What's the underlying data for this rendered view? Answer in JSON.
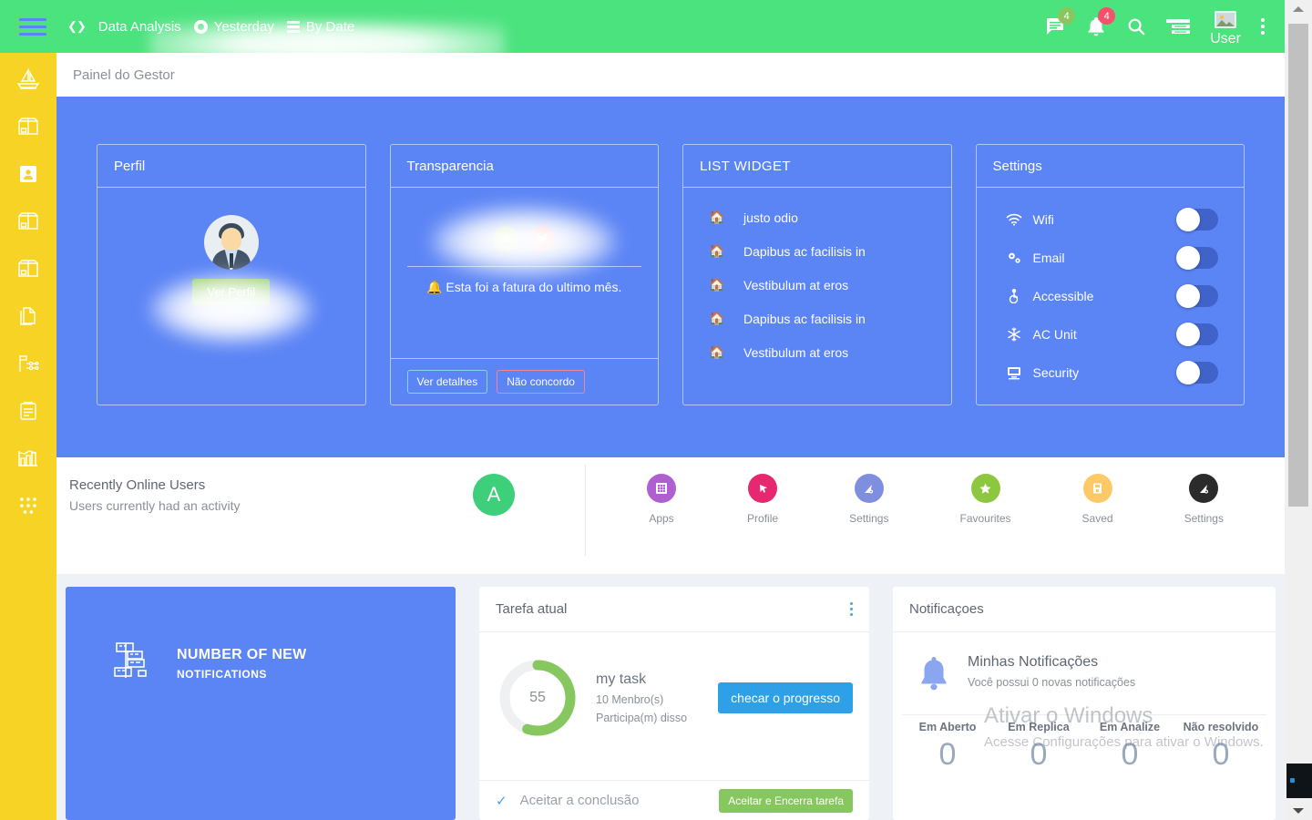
{
  "topbar": {
    "code_icon": "code-icon",
    "items": [
      {
        "label": "Data Analysis",
        "icon": "none"
      },
      {
        "label": "Yesterday",
        "icon": "clock-icon"
      },
      {
        "label": "By Date",
        "icon": "bars-icon"
      }
    ],
    "messages_badge": "4",
    "notifications_badge": "4",
    "user_label": "User",
    "colors": {
      "bar": "#4ae37e",
      "badge_green": "#87c75f",
      "badge_red": "#f4516c"
    }
  },
  "sidebar": {
    "items": [
      {
        "icon": "sailboat-icon"
      },
      {
        "icon": "box-icon"
      },
      {
        "icon": "contact-card-icon"
      },
      {
        "icon": "box-icon"
      },
      {
        "icon": "box-icon"
      },
      {
        "icon": "documents-icon"
      },
      {
        "icon": "flowchart-icon"
      },
      {
        "icon": "clipboard-icon"
      },
      {
        "icon": "bar-chart-icon"
      },
      {
        "icon": "grid-dots-icon"
      }
    ],
    "color": "#f7d325"
  },
  "breadcrumb": {
    "title": "Painel do Gestor"
  },
  "panel": {
    "color": "#5b84f5",
    "profile_card": {
      "title": "Perfil",
      "avatar": "user-avatar",
      "name_redacted": "",
      "email_redacted": "",
      "button": "Ver Perfil"
    },
    "transparencia_card": {
      "title": "Transparencia",
      "amount_redacted": "",
      "up_icon": "double-chevron-up-icon",
      "down_icon": "double-chevron-down-icon",
      "note": "Esta foi a fatura do ultimo mês.",
      "note_icon": "bell-icon",
      "btn_details": "Ver detalhes",
      "btn_disagree": "Não concordo"
    },
    "list_widget": {
      "title": "LIST WIDGET",
      "items": [
        {
          "icon": "home-icon",
          "label": "justo odio"
        },
        {
          "icon": "home-icon",
          "label": "Dapibus ac facilisis in"
        },
        {
          "icon": "home-icon",
          "label": "Vestibulum at eros"
        },
        {
          "icon": "home-icon",
          "label": "Dapibus ac facilisis in"
        },
        {
          "icon": "home-icon",
          "label": "Vestibulum at eros"
        }
      ]
    },
    "settings_card": {
      "title": "Settings",
      "rows": [
        {
          "icon": "wifi-icon",
          "label": "Wifi",
          "on": false
        },
        {
          "icon": "gears-icon",
          "label": "Email",
          "on": false
        },
        {
          "icon": "wheelchair-icon",
          "label": "Accessible",
          "on": false
        },
        {
          "icon": "snowflake-icon",
          "label": "AC Unit",
          "on": false
        },
        {
          "icon": "security-icon",
          "label": "Security",
          "on": false
        }
      ]
    }
  },
  "recent_strip": {
    "title": "Recently Online Users",
    "subtitle": "Users currently had an activity",
    "avatar_initial": "A",
    "avatar_color": "#3dcf7a",
    "quick_actions": [
      {
        "label": "Apps",
        "icon": "grid-icon",
        "color": "#b05fd1"
      },
      {
        "label": "Profile",
        "icon": "cursor-icon",
        "color": "#e5286f"
      },
      {
        "label": "Settings",
        "icon": "nav-gear-icon",
        "color": "#7f8fe0"
      },
      {
        "label": "Favourites",
        "icon": "star-icon",
        "color": "#8dc63f"
      },
      {
        "label": "Saved",
        "icon": "save-icon",
        "color": "#fcc966"
      },
      {
        "label": "Settings",
        "icon": "nav-gear-icon",
        "color": "#2b2b2b"
      }
    ]
  },
  "notifications_banner": {
    "icon": "stacked-boxes-icon",
    "title": "NUMBER OF NEW",
    "subtitle": "NOTIFICATIONS"
  },
  "task_card": {
    "title": "Tarefa atual",
    "menu_icon": "kebab-menu-icon",
    "progress_value": "55",
    "progress_percent": 55,
    "progress_color": "#87c75f",
    "task_name": "my task",
    "members_line": "10 Menbro(s)",
    "members_line2": "Participa(m) disso",
    "check_button": "checar o progresso",
    "footer_check_icon": "check-icon",
    "footer_label": "Aceitar a conclusão",
    "footer_button": "Aceitar e Encerra tarefa"
  },
  "notif_card": {
    "title": "Notificaçoes",
    "bell_icon": "bell-icon",
    "heading": "Minhas Notificações",
    "sub": "Você possui 0 novas notificações",
    "stats": [
      {
        "label": "Em Aberto",
        "value": "0"
      },
      {
        "label": "Em Replica",
        "value": "0"
      },
      {
        "label": "Em Analize",
        "value": "0"
      },
      {
        "label": "Não resolvido",
        "value": "0"
      }
    ]
  },
  "watermark": {
    "line1": "Ativar o Windows",
    "line2": "Acesse Configurações para ativar o Windows."
  }
}
